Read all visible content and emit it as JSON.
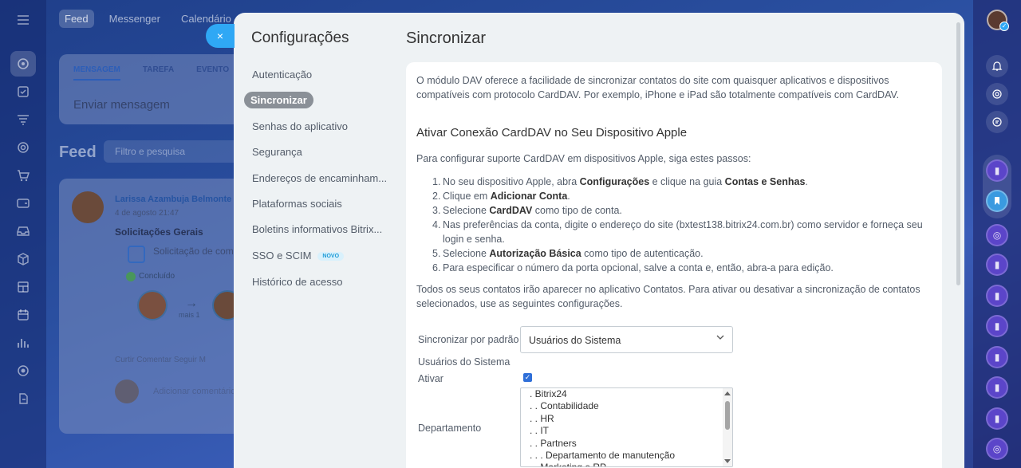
{
  "left_rail": {
    "icons": [
      "menu-icon",
      "activity-icon",
      "tasks-icon",
      "funnel-icon",
      "target-icon",
      "cart-icon",
      "wallet-icon",
      "inbox-icon",
      "box-icon",
      "building-icon",
      "calendar-icon",
      "chart-icon",
      "settings-icon",
      "arrow-icon"
    ]
  },
  "background": {
    "tabs": [
      "Feed",
      "Messenger",
      "Calendário"
    ],
    "post_tabs": [
      "MENSAGEM",
      "TAREFA",
      "EVENTO"
    ],
    "post_placeholder": "Enviar mensagem",
    "feed_title": "Feed",
    "search_placeholder": "Filtro e pesquisa",
    "card": {
      "author": "Larissa Azambuja Belmonte",
      "date": "4 de agosto 21:47",
      "title": "Solicitações Gerais",
      "request": "Solicitação de comp",
      "status": "Concluído",
      "more": "mais 1",
      "actions": "Curtir   Comentar   Seguir   M",
      "comment_placeholder": "Adicionar comentário"
    }
  },
  "close_label": "×",
  "panel": {
    "nav_title": "Configurações",
    "nav_items": [
      {
        "label": "Autenticação",
        "active": false
      },
      {
        "label": "Sincronizar",
        "active": true
      },
      {
        "label": "Senhas do aplicativo",
        "active": false
      },
      {
        "label": "Segurança",
        "active": false
      },
      {
        "label": "Endereços de encaminham...",
        "active": false
      },
      {
        "label": "Plataformas sociais",
        "active": false
      },
      {
        "label": "Boletins informativos Bitrix...",
        "active": false
      },
      {
        "label": "SSO e SCIM",
        "active": false,
        "badge": "NOVO"
      },
      {
        "label": "Histórico de acesso",
        "active": false
      }
    ],
    "page_title": "Sincronizar",
    "intro": "O módulo DAV oferece a facilidade de sincronizar contatos do site com quaisquer aplicativos e dispositivos compatíveis com protocolo CardDAV. Por exemplo, iPhone e iPad são totalmente compatíveis com CardDAV.",
    "heading": "Ativar Conexão CardDAV no Seu Dispositivo Apple",
    "steps_intro": "Para configurar suporte CardDAV em dispositivos Apple, siga estes passos:",
    "steps": [
      {
        "num": "1.",
        "parts": [
          {
            "t": "No seu dispositivo Apple, abra "
          },
          {
            "b": "Configurações"
          },
          {
            "t": " e clique na guia "
          },
          {
            "b": "Contas e Senhas"
          },
          {
            "t": "."
          }
        ]
      },
      {
        "num": "2.",
        "parts": [
          {
            "t": "Clique em "
          },
          {
            "b": "Adicionar Conta"
          },
          {
            "t": "."
          }
        ]
      },
      {
        "num": "3.",
        "parts": [
          {
            "t": "Selecione "
          },
          {
            "b": "CardDAV"
          },
          {
            "t": " como tipo de conta."
          }
        ]
      },
      {
        "num": "4.",
        "parts": [
          {
            "t": "Nas preferências da conta, digite o endereço do site (bxtest138.bitrix24.com.br) como servidor e forneça seu login e senha."
          }
        ]
      },
      {
        "num": "5.",
        "parts": [
          {
            "t": "Selecione "
          },
          {
            "b": "Autorização Básica"
          },
          {
            "t": " como tipo de autenticação."
          }
        ]
      },
      {
        "num": "6.",
        "parts": [
          {
            "t": "Para especificar o número da porta opcional, salve a conta e, então, abra-a para edição."
          }
        ]
      }
    ],
    "outro": "Todos os seus contatos irão aparecer no aplicativo Contatos. Para ativar ou desativar a sincronização de contatos selecionados, use as seguintes configurações.",
    "form": {
      "sync_label": "Sincronizar por padrão",
      "sync_value": "Usuários do Sistema",
      "section_label": "Usuários do Sistema",
      "activate_label": "Ativar",
      "activate_checked": true,
      "department_label": "Departamento",
      "departments": [
        ". Bitrix24",
        ". . Contabilidade",
        ". . HR",
        ". . IT",
        ". . Partners",
        ". . . Departamento de manutenção",
        ". . Marketing e RP"
      ]
    }
  },
  "right_rail": {
    "icons": [
      "bell-icon",
      "target-icon",
      "chat-icon",
      "contact-icon",
      "bookmark-icon",
      "copilot-icon",
      "contact-icon",
      "contact-icon",
      "contact-icon",
      "contact-icon",
      "contact-icon",
      "copilot-icon"
    ]
  }
}
